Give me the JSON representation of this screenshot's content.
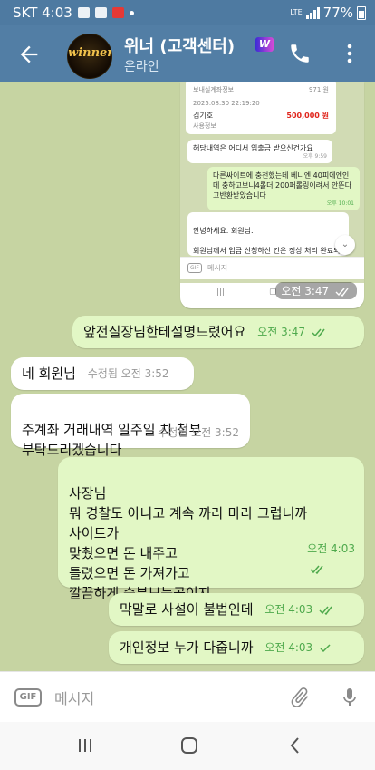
{
  "status_bar": {
    "carrier_time": "SKT 4:03",
    "network": "LTE",
    "battery": "77%"
  },
  "header": {
    "avatar_text": "winner",
    "title": "위너 (고객센터)",
    "badge": "W",
    "status": "온라인"
  },
  "screenshot": {
    "card_labels": [
      "보내실계좌정보",
      "971 원",
      "2025.08.30 22:19:20",
      "김기호",
      "500,000 원",
      "사용정보"
    ],
    "bubbles": [
      {
        "text": "해당내역은 어디서 입출금 받으신건가요",
        "time": "오후 9:59"
      },
      {
        "text": "다른싸이트에 충전했는데 베니엔 40피에엔인데 충하고보니4롤더 200퍼롤링이려서 안뜬다고반환받았습니다",
        "time": "오후 10:01"
      },
      {
        "text": "안녕하세요. 회원님.\n\n회원님께서 입금 신청하신 건은 정상 처리 완료되었습니다.",
        "time": ""
      }
    ],
    "input_placeholder": "메시지",
    "timestamp": "오전 3:47"
  },
  "messages": [
    {
      "direction": "out",
      "text": "앞전실장님한테설명드렸어요",
      "meta": "오전 3:47"
    },
    {
      "direction": "in",
      "text": "네 회원님",
      "meta": "수정됨 오전 3:52"
    },
    {
      "direction": "in",
      "text": "주계좌 거래내역 일주일 치 첨부\n부탁드리겠습니다",
      "meta": "수정됨 오전 3:52"
    },
    {
      "direction": "out",
      "text": "사장님\n뭐 경찰도 아니고 계속 까라 마라 그럽니까\n사이트가\n맞췄으면 돈 내주고\n틀렸으면 돈 가져가고\n깔끔하게 승부보는곳이지",
      "meta": "오전 4:03"
    },
    {
      "direction": "out",
      "text": "막말로 사설이 불법인데",
      "meta": "오전 4:03"
    },
    {
      "direction": "out",
      "text": "개인정보 누가 다줍니까",
      "meta": "오전 4:03"
    }
  ],
  "composer": {
    "gif_label": "GIF",
    "placeholder": "메시지"
  },
  "colors": {
    "header": "#527ea5",
    "outgoing_bubble": "#e2f7c5",
    "incoming_bubble": "#ffffff",
    "read_ticks": "#4ea94c",
    "chat_background": "#c6d4a2"
  }
}
